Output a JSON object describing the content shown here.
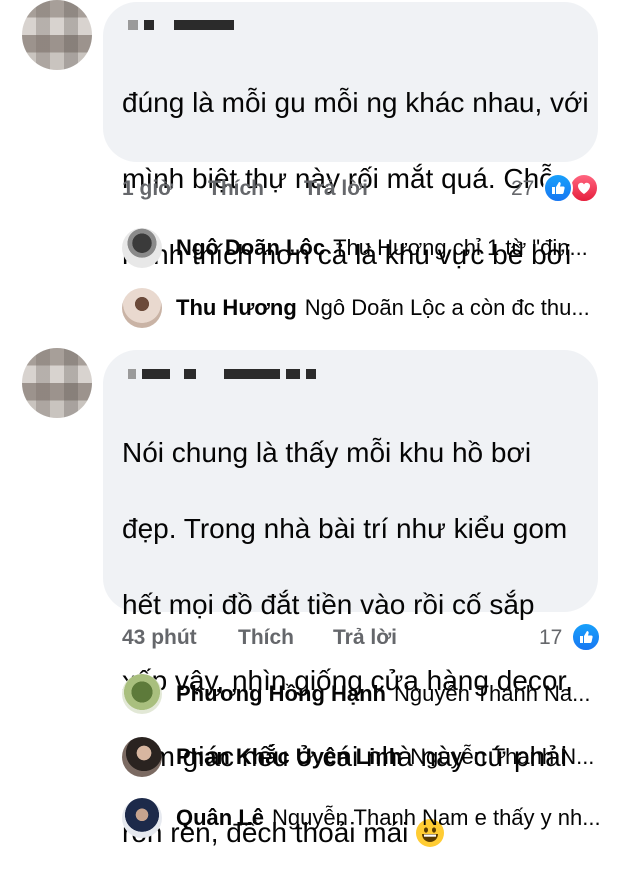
{
  "comments": [
    {
      "text_lines": [
        "đúng là mỗi gu mỗi ng khác nhau, với",
        "mình biệt thự này rối mắt quá. Chỗ",
        "mình thích hơn cả là khu vực bể bơi"
      ],
      "time": "1 giờ",
      "like_label": "Thích",
      "reply_label": "Trả lời",
      "reaction_count": "27",
      "reactions": [
        "like-icon",
        "love-icon"
      ],
      "replies": [
        {
          "name": "Ngô Doãn Lộc",
          "text": "Thu Hương chỉ 1 từ \"đin..."
        },
        {
          "name": "Thu Hương",
          "text": "Ngô Doãn Lộc  a còn đc thu..."
        }
      ]
    },
    {
      "text_lines": [
        "Nói chung là thấy mỗi khu hồ bơi",
        "đẹp. Trong nhà bài trí như kiểu gom",
        "hết mọi đồ đắt tiền vào rồi cố sắp",
        "xếp vậy, nhìn giống cửa hàng decor,",
        "cảm giác nếu ở cái nhà này cứ phải",
        "rón rén, đếch thoải mái"
      ],
      "time": "43 phút",
      "like_label": "Thích",
      "reply_label": "Trả lời",
      "reaction_count": "17",
      "reactions": [
        "like-icon"
      ],
      "replies": [
        {
          "name": "Phương Hồng Hạnh",
          "text": "Nguyễn Thanh Na..."
        },
        {
          "name": "Phan Khắc Uyên Linh",
          "text": "Nguyễn Thanh N..."
        },
        {
          "name": "Quân Lê",
          "text": "Nguyễn Thanh Nam e thấy y nh..."
        }
      ]
    }
  ],
  "colors": {
    "bubble": "#f0f2f5",
    "meta": "#65676b",
    "like": "#1877f2",
    "love": "#e61e3c"
  }
}
